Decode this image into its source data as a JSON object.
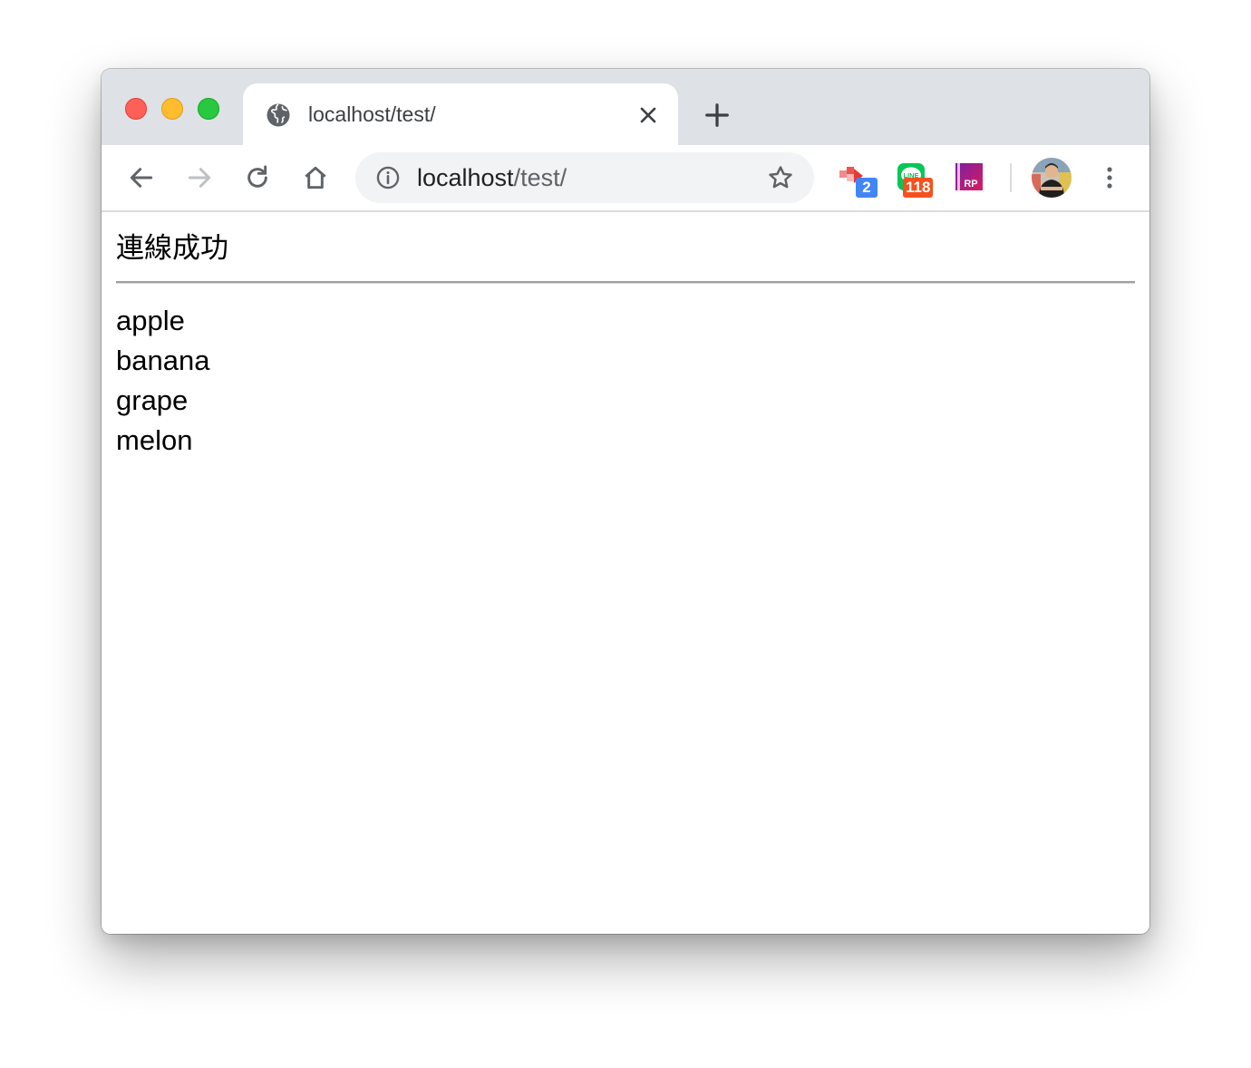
{
  "window": {
    "tab": {
      "title": "localhost/test/",
      "favicon": "globe-icon"
    },
    "new_tab_icon": "plus-icon"
  },
  "toolbar": {
    "back_icon": "arrow-left-icon",
    "forward_icon": "arrow-right-icon",
    "reload_icon": "reload-icon",
    "home_icon": "home-icon",
    "omnibox": {
      "host": "localhost",
      "path": "/test/",
      "info_icon": "info-icon",
      "bookmark_icon": "star-icon"
    },
    "extensions": [
      {
        "name": "red-arrow-extension-icon",
        "badge": "2",
        "badge_color": "#4285f4"
      },
      {
        "name": "line-extension-icon",
        "label": "LINE",
        "badge": "118",
        "badge_color": "#f4511e"
      },
      {
        "name": "rp-extension-icon",
        "label": "RP"
      }
    ],
    "profile_icon": "avatar",
    "menu_icon": "more-vert-icon"
  },
  "page": {
    "heading": "連線成功",
    "items": [
      "apple",
      "banana",
      "grape",
      "melon"
    ]
  },
  "colors": {
    "tabstrip": "#dee1e6",
    "omnibox": "#f1f3f4",
    "close": "#fe5f57",
    "minimize": "#febc2e",
    "maximize": "#28c840"
  }
}
